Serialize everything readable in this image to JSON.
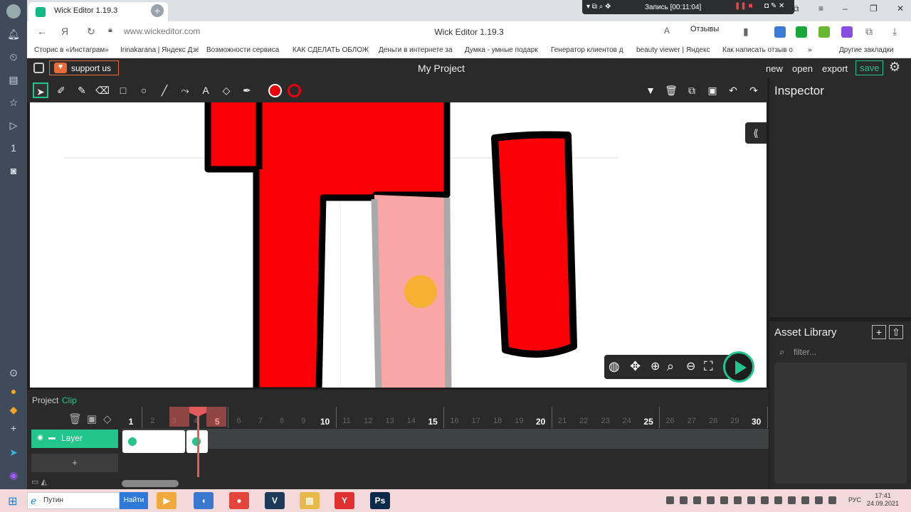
{
  "browser": {
    "tab": {
      "title": "Wick Editor 1.19.3",
      "close": "×",
      "newtab": "+"
    },
    "recording": {
      "label": "Запись [00:11:04]"
    },
    "address": {
      "url": "www.wickeditor.com",
      "page_title": "Wick Editor 1.19.3",
      "reviews": "Отзывы",
      "reader": "A"
    },
    "bookmarks": [
      "Сторис в «Инстаграм»",
      "Irinakarana | Яндекс Дзен",
      "Возможности сервиса",
      "КАК СДЕЛАТЬ ОБЛОЖ",
      "Деньги в интернете за",
      "Думка - умные подарк",
      "Генератор клиентов д",
      "beauty viewer | Яндекс",
      "Как написать отзыв о"
    ],
    "bookmarks_more": "»",
    "bookmarks_other": "Другие закладки"
  },
  "app": {
    "support_label": "support us",
    "project_title": "My Project",
    "menu": {
      "new": "new",
      "open": "open",
      "export": "export",
      "save": "save"
    },
    "inspector_title": "Inspector",
    "asset_library": {
      "title": "Asset Library",
      "filter_placeholder": "filter...",
      "add": "+",
      "upload": "⇧"
    },
    "timeline": {
      "tabs": [
        "Project",
        "Clip"
      ],
      "layer_name": "Layer",
      "add_layer": "+",
      "frame_numbers": [
        "1",
        "2",
        "3",
        "4",
        "5",
        "6",
        "7",
        "8",
        "9",
        "10",
        "11",
        "12",
        "13",
        "14",
        "15",
        "16",
        "17",
        "18",
        "19",
        "20",
        "21",
        "22",
        "23",
        "24",
        "25",
        "26",
        "27",
        "28",
        "29",
        "30"
      ],
      "playhead_frame": 4
    },
    "colors": {
      "accent": "#22c58b",
      "fill": "#e8000b",
      "playhead": "#e45b5b"
    }
  },
  "taskbar": {
    "search_placeholder": "Путин",
    "search_button": "Найти",
    "apps": [
      {
        "label": "▶",
        "color": "#f2a93b"
      },
      {
        "label": "◖",
        "color": "#3a78d0"
      },
      {
        "label": "●",
        "color": "#e4453a"
      },
      {
        "label": "V",
        "color": "#1e3a5a"
      },
      {
        "label": "▤",
        "color": "#e8b84a"
      },
      {
        "label": "Y",
        "color": "#e23030"
      },
      {
        "label": "Ps",
        "color": "#0b2a4a"
      }
    ],
    "lang": "РУС",
    "time": "17:41",
    "date": "24.09.2021"
  }
}
